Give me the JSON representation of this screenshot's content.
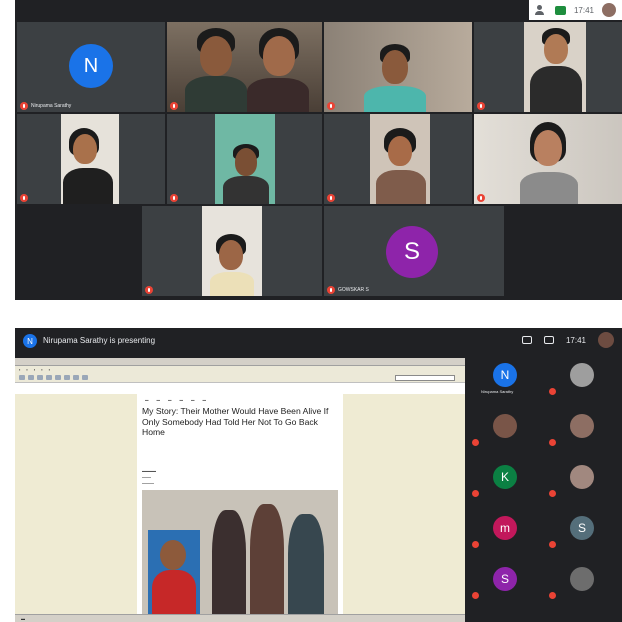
{
  "gallery": {
    "clock": "17:41",
    "tiles": [
      {
        "name": "Nirupama Sarathy",
        "avatar": "N",
        "color": "#1a73e8"
      },
      {
        "name": "",
        "video": true
      },
      {
        "name": "",
        "video": true
      },
      {
        "name": "",
        "video": true
      },
      {
        "name": "",
        "video": true
      },
      {
        "name": "",
        "video": true
      },
      {
        "name": "",
        "video": true
      },
      {
        "name": "",
        "video": true
      },
      {
        "name": "",
        "video": true
      },
      {
        "name": "GOWSKAR S",
        "avatar": "S",
        "color": "#8e24aa"
      }
    ]
  },
  "presentation": {
    "presenter_initial": "N",
    "title": "Nirupama Sarathy is presenting",
    "clock": "17:41",
    "article": {
      "headline": "My Story: Their Mother Would Have Been Alive If Only Somebody Had Told Her Not To Go Back Home"
    },
    "participants": [
      {
        "name": "Nirupama Sarathy",
        "avatar": "N",
        "color": "#1a73e8",
        "photo": false
      },
      {
        "name": "",
        "avatar": "",
        "color": "#9e9e9e",
        "photo": true
      },
      {
        "name": "",
        "avatar": "",
        "color": "#795548",
        "photo": true
      },
      {
        "name": "",
        "avatar": "",
        "color": "#8d6e63",
        "photo": true
      },
      {
        "name": "",
        "avatar": "K",
        "color": "#0b8043",
        "photo": false
      },
      {
        "name": "",
        "avatar": "",
        "color": "#a1887f",
        "photo": true
      },
      {
        "name": "",
        "avatar": "m",
        "color": "#c2185b",
        "photo": false
      },
      {
        "name": "",
        "avatar": "S",
        "color": "#546e7a",
        "photo": false
      },
      {
        "name": "",
        "avatar": "S",
        "color": "#8e24aa",
        "photo": false
      },
      {
        "name": "",
        "avatar": "",
        "color": "#6d6d6d",
        "photo": true
      }
    ]
  },
  "colors": {
    "meet_dark": "#202124",
    "tile_bg": "#3c4043",
    "mic_off": "#ea4335",
    "doc_bg": "#efebd3"
  }
}
